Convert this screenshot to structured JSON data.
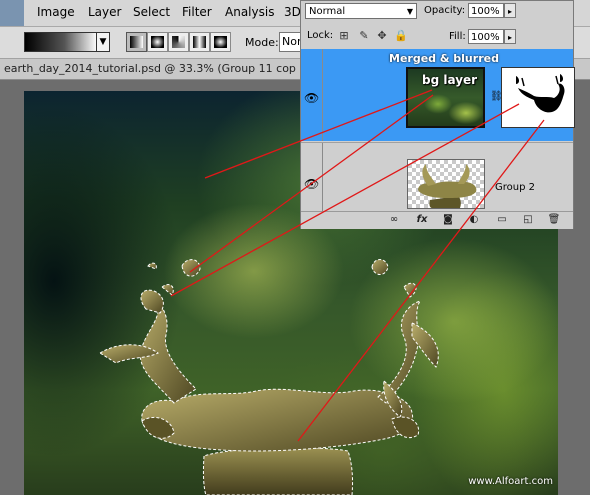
{
  "menu": {
    "items": [
      "Image",
      "Layer",
      "Select",
      "Filter",
      "Analysis",
      "3D"
    ]
  },
  "options_bar": {
    "mode_label": "Mode:",
    "mode_value": "Nor"
  },
  "document": {
    "tab_title": "earth_day_2014_tutorial.psd @ 33.3% (Group 11 cop"
  },
  "canvas": {
    "watermark": "www.Alfoart.com"
  },
  "layers_panel": {
    "blend_mode": "Normal",
    "opacity_label": "Opacity:",
    "opacity_value": "100%",
    "lock_label": "Lock:",
    "fill_label": "Fill:",
    "fill_value": "100%",
    "layers": [
      {
        "name": "Merged & blurred",
        "thumb_caption": "bg layer",
        "selected": true
      },
      {
        "name": "Group 2",
        "selected": false
      }
    ]
  },
  "colors": {
    "selected_row": "#3b99f4",
    "annotation_lines": "#e01818",
    "panel_bg": "#cfcfcf"
  }
}
